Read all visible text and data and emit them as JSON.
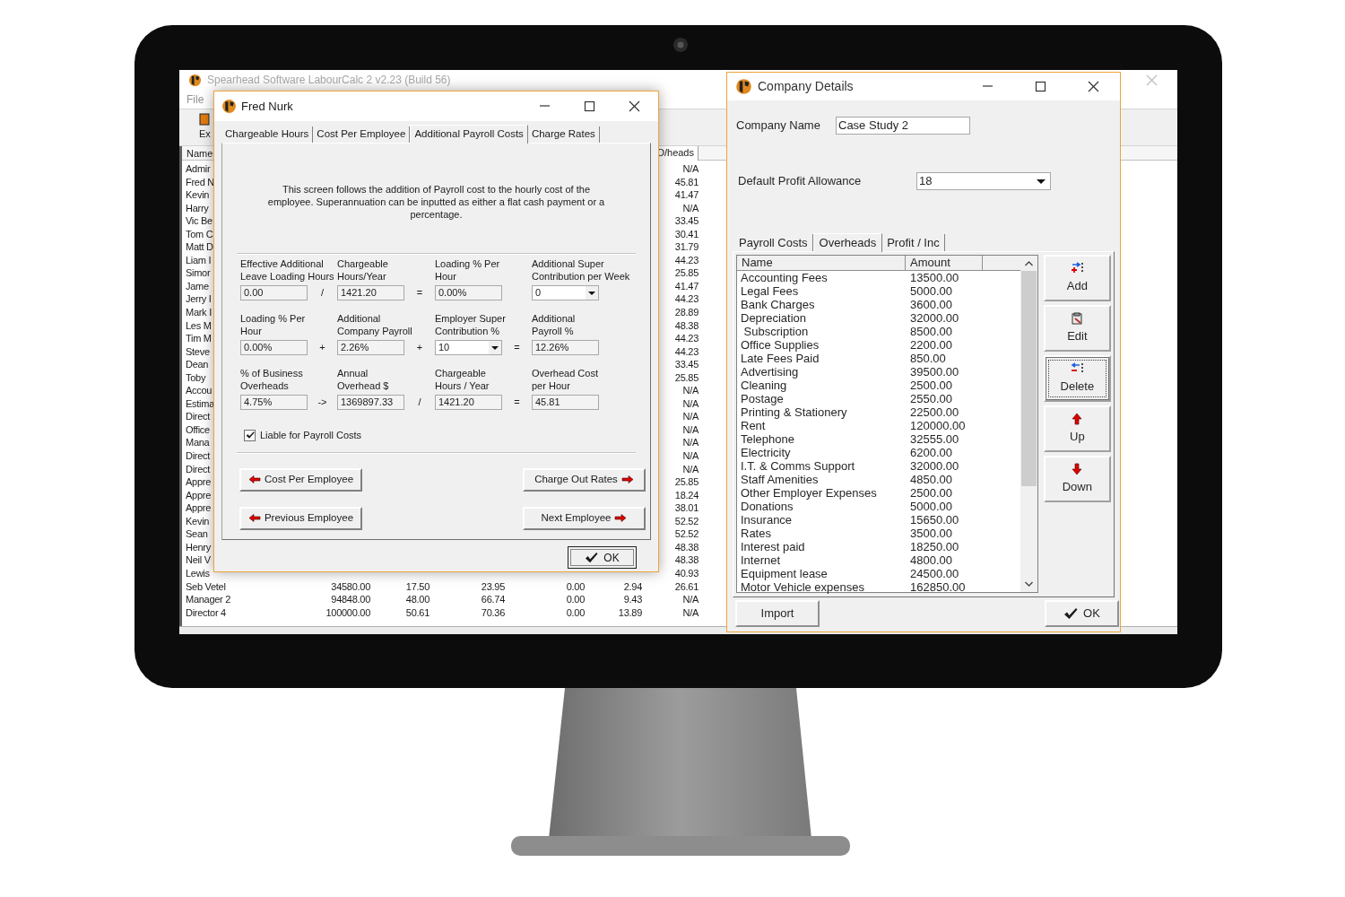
{
  "background_window": {
    "title": "Spearhead Software LabourCalc 2 v2.23 (Build 56)",
    "menu": [
      "File"
    ],
    "toolbar": [
      {
        "label": "Ex"
      }
    ],
    "table": {
      "columns": [
        "Name",
        "O/heads"
      ],
      "rows": [
        {
          "name": "Admir",
          "o_heads": "N/A"
        },
        {
          "name": "Fred N",
          "o_heads": "45.81"
        },
        {
          "name": "Kevin",
          "o_heads": "41.47"
        },
        {
          "name": "Harry",
          "o_heads": "N/A"
        },
        {
          "name": "Vic Be",
          "o_heads": "33.45"
        },
        {
          "name": "Tom C",
          "o_heads": "30.41"
        },
        {
          "name": "Matt D",
          "o_heads": "31.79"
        },
        {
          "name": "Liam I",
          "o_heads": "44.23"
        },
        {
          "name": "Simor",
          "o_heads": "25.85"
        },
        {
          "name": "Jame",
          "o_heads": "41.47"
        },
        {
          "name": "Jerry I",
          "o_heads": "44.23"
        },
        {
          "name": "Mark I",
          "o_heads": "28.89"
        },
        {
          "name": "Les M",
          "o_heads": "48.38"
        },
        {
          "name": "Tim M",
          "o_heads": "44.23"
        },
        {
          "name": "Steve",
          "o_heads": "44.23"
        },
        {
          "name": "Dean",
          "o_heads": "33.45"
        },
        {
          "name": "Toby",
          "o_heads": "25.85"
        },
        {
          "name": "Accou",
          "o_heads": "N/A"
        },
        {
          "name": "Estima",
          "o_heads": "N/A"
        },
        {
          "name": "Direct",
          "o_heads": "N/A"
        },
        {
          "name": "Office",
          "o_heads": "N/A"
        },
        {
          "name": "Mana",
          "o_heads": "N/A"
        },
        {
          "name": "Direct",
          "o_heads": "N/A"
        },
        {
          "name": "Direct",
          "o_heads": "N/A"
        },
        {
          "name": "Appre",
          "o_heads": "25.85"
        },
        {
          "name": "Appre",
          "o_heads": "18.24"
        },
        {
          "name": "Appre",
          "o_heads": "38.01"
        },
        {
          "name": "Kevin",
          "o_heads": "52.52"
        },
        {
          "name": "Sean",
          "o_heads": "52.52"
        },
        {
          "name": "Henry",
          "o_heads": "48.38"
        },
        {
          "name": "Neil V",
          "o_heads": "48.38"
        },
        {
          "name": "Lewis",
          "o_heads": "40.93"
        },
        {
          "name": "Seb Vetel",
          "cells": [
            "34580.00",
            "17.50",
            "23.95",
            "0.00",
            "2.94"
          ],
          "o_heads": "26.61"
        },
        {
          "name": "Manager 2",
          "cells": [
            "94848.00",
            "48.00",
            "66.74",
            "0.00",
            "9.43"
          ],
          "o_heads": "N/A"
        },
        {
          "name": "Director 4",
          "cells": [
            "100000.00",
            "50.61",
            "70.36",
            "0.00",
            "13.89"
          ],
          "o_heads": "N/A"
        }
      ]
    }
  },
  "employee_dialog": {
    "title": "Fred Nurk",
    "tabs": [
      {
        "label": "Chargeable Hours",
        "selected": false
      },
      {
        "label": "Cost Per Employee",
        "selected": false
      },
      {
        "label": "Additional Payroll Costs",
        "selected": true
      },
      {
        "label": "Charge Rates",
        "selected": false
      }
    ],
    "description": "This screen follows the addition of Payroll cost to the hourly cost of the employee.  Superannuation can be inputted as either a flat cash payment or a percentage.",
    "formula_rows": [
      {
        "fields": [
          {
            "label": "Effective Additional\nLeave Loading Hours",
            "kind": "text",
            "value": "0.00"
          },
          {
            "operator_before": "/",
            "label": "Chargeable\nHours/Year",
            "kind": "text",
            "value": "1421.20"
          },
          {
            "operator_before": "=",
            "label": "Loading % Per\nHour",
            "kind": "text",
            "value": "0.00%"
          },
          {
            "label": "Additional Super\nContribution per Week",
            "kind": "dropdown",
            "value": "0"
          }
        ]
      },
      {
        "fields": [
          {
            "label": "Loading % Per\nHour",
            "kind": "text",
            "value": "0.00%"
          },
          {
            "operator_before": "+",
            "label": "Additional\nCompany Payroll",
            "kind": "text",
            "value": "2.26%"
          },
          {
            "operator_before": "+",
            "label": "Employer Super\nContribution %",
            "kind": "dropdown",
            "value": "10"
          },
          {
            "operator_before": "=",
            "label": "Additional\nPayroll %",
            "kind": "text",
            "value": "12.26%"
          }
        ]
      },
      {
        "fields": [
          {
            "label": "% of Business\nOverheads",
            "kind": "text",
            "value": "4.75%"
          },
          {
            "operator_before": "->",
            "label": "Annual\nOverhead $",
            "kind": "text",
            "value": "1369897.33"
          },
          {
            "operator_before": "/",
            "label": "Chargeable\nHours / Year",
            "kind": "text",
            "value": "1421.20"
          },
          {
            "operator_before": "=",
            "label": "Overhead Cost\nper Hour",
            "kind": "text",
            "value": "45.81"
          }
        ]
      }
    ],
    "checkbox": {
      "label": "Liable for Payroll Costs",
      "checked": true
    },
    "nav_buttons": [
      {
        "label": "Cost Per Employee",
        "kind": "back"
      },
      {
        "label": "Charge Out Rates",
        "kind": "forward"
      },
      {
        "label": "Previous Employee",
        "kind": "back"
      },
      {
        "label": "Next Employee",
        "kind": "forward"
      }
    ],
    "ok_button": "OK"
  },
  "company_dialog": {
    "title": "Company Details",
    "company_name": {
      "label": "Company Name",
      "value": "Case Study 2"
    },
    "profit_allowance": {
      "label": "Default Profit Allowance",
      "value": "18"
    },
    "tabs": [
      {
        "label": "Payroll Costs",
        "selected": false
      },
      {
        "label": "Overheads",
        "selected": true
      },
      {
        "label": "Profit / Inc",
        "selected": false
      }
    ],
    "list": {
      "columns": [
        "Name",
        "Amount"
      ],
      "rows": [
        {
          "name": "Accounting Fees",
          "amount": "13500.00"
        },
        {
          "name": "Legal Fees",
          "amount": "5000.00"
        },
        {
          "name": "Bank Charges",
          "amount": "3600.00"
        },
        {
          "name": "Depreciation",
          "amount": "32000.00"
        },
        {
          "name": " Subscription",
          "amount": "8500.00"
        },
        {
          "name": "Office Supplies",
          "amount": "2200.00"
        },
        {
          "name": "Late Fees Paid",
          "amount": "850.00"
        },
        {
          "name": "Advertising",
          "amount": "39500.00"
        },
        {
          "name": "Cleaning",
          "amount": "2500.00"
        },
        {
          "name": "Postage",
          "amount": "2550.00"
        },
        {
          "name": "Printing & Stationery",
          "amount": "22500.00"
        },
        {
          "name": "Rent",
          "amount": "120000.00"
        },
        {
          "name": "Telephone",
          "amount": "32555.00"
        },
        {
          "name": "Electricity",
          "amount": "6200.00"
        },
        {
          "name": "I.T. & Comms Support",
          "amount": "32000.00"
        },
        {
          "name": "Staff Amenities",
          "amount": "4850.00"
        },
        {
          "name": "Other Employer Expenses",
          "amount": "2500.00"
        },
        {
          "name": "Donations",
          "amount": "5000.00"
        },
        {
          "name": "Insurance",
          "amount": "15650.00"
        },
        {
          "name": "Rates",
          "amount": "3500.00"
        },
        {
          "name": "Interest paid",
          "amount": "18250.00"
        },
        {
          "name": "Internet",
          "amount": "4800.00"
        },
        {
          "name": "Equipment lease",
          "amount": "24500.00"
        },
        {
          "name": "Motor Vehicle expenses",
          "amount": "162850.00"
        }
      ]
    },
    "side_buttons": [
      {
        "label": "Add",
        "kind": "add",
        "focused": false
      },
      {
        "label": "Edit",
        "kind": "edit",
        "focused": false
      },
      {
        "label": "Delete",
        "kind": "delete",
        "focused": true
      },
      {
        "label": "Up",
        "kind": "up",
        "focused": false
      },
      {
        "label": "Down",
        "kind": "down",
        "focused": false
      }
    ],
    "import_button": "Import",
    "ok_button": "OK"
  }
}
